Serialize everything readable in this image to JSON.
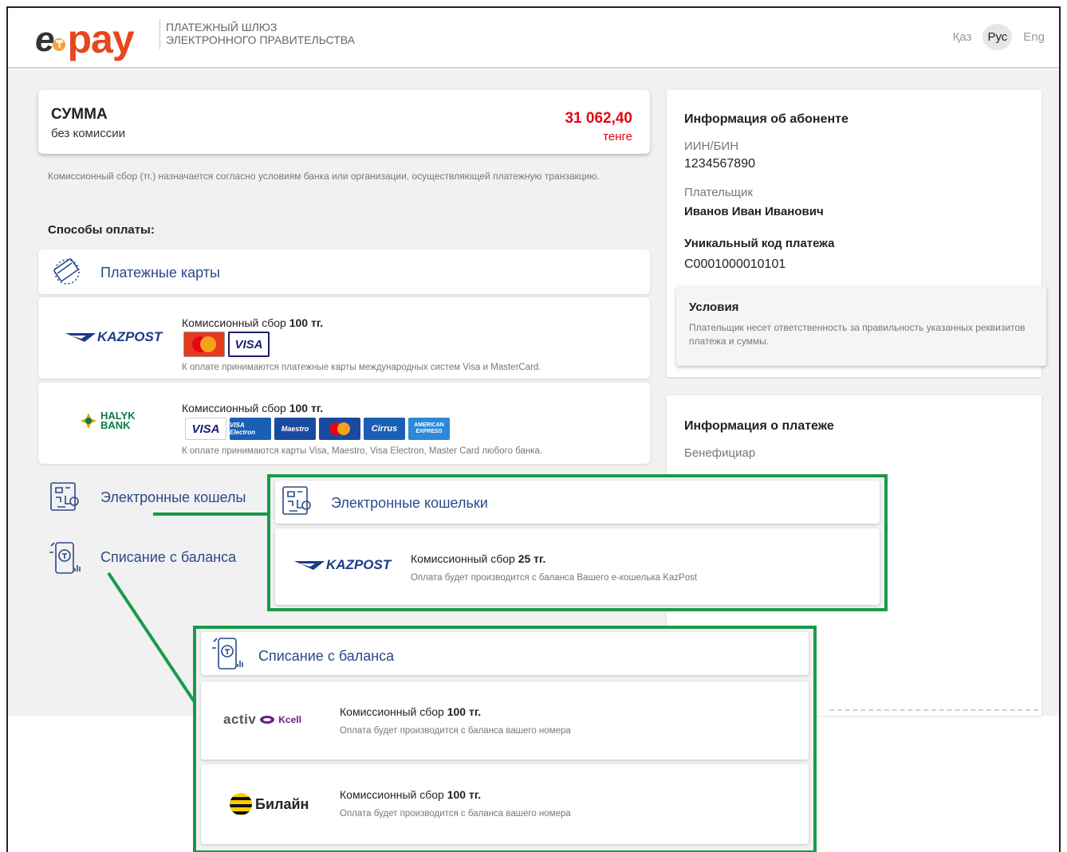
{
  "header": {
    "logo_e": "e",
    "logo_o": "₸",
    "logo_pay": "pay",
    "caption_line1": "ПЛАТЕЖНЫЙ ШЛЮЗ",
    "caption_line2": "ЭЛЕКТРОННОГО ПРАВИТЕЛЬСТВА",
    "languages": [
      {
        "label": "Қаз",
        "active": false
      },
      {
        "label": "Рус",
        "active": true
      },
      {
        "label": "Eng",
        "active": false
      }
    ]
  },
  "sum": {
    "title": "СУММА",
    "subtitle": "без комиссии",
    "amount": "31 062,40",
    "currency": "тенге"
  },
  "commission_note": "Комиссионный сбор (тг.) назначается согласно условиям банка или организации, осуществляющей платежную транзакцию.",
  "methods_title": "Способы оплаты:",
  "payment_cards": {
    "label": "Платежные карты",
    "kazpost": {
      "logo": "KAZPOST",
      "fee_prefix": "Комиссионный сбор",
      "fee_value": "100 тг.",
      "badges": [
        "MasterCard",
        "VISA"
      ],
      "note": "К оплате принимаются платежные карты международных систем Visa и MasterCard."
    },
    "halyk": {
      "logo_line1": "HALYK",
      "logo_line2": "BANK",
      "fee_prefix": "Комиссионный сбор",
      "fee_value": "100 тг.",
      "badges": [
        "VISA",
        "VISA Electron",
        "Maestro",
        "MasterCard",
        "Cirrus",
        "AMERICAN EXPRESS"
      ],
      "note": "К оплате принимаются карты Visa, Maestro, Visa Electron, Master Card любого банка."
    }
  },
  "side_menu": {
    "wallets": "Электронные кошелы",
    "balance": "Списание с баланса"
  },
  "wallet_overlay": {
    "label": "Электронные кошельки",
    "logo": "KAZPOST",
    "fee_prefix": "Комиссионный сбор",
    "fee_value": "25 тг.",
    "note": "Оплата будет производится с баланса Вашего е-кошелька KazPost"
  },
  "balance_overlay": {
    "label": "Списание с баланса",
    "activ": {
      "logo_text": "activ",
      "kcell_text": "Kcell",
      "fee_prefix": "Комиссионный сбор",
      "fee_value": "100 тг.",
      "note": "Оплата будет производится с баланса вашего номера"
    },
    "beeline": {
      "logo_text": "Билайн",
      "fee_prefix": "Комиссионный сбор",
      "fee_value": "100 тг.",
      "note": "Оплата будет производится с баланса вашего номера"
    }
  },
  "subscriber": {
    "title": "Информация об абоненте",
    "iin_label": "ИИН/БИН",
    "iin_value": "1234567890",
    "payer_label": "Плательщик",
    "payer_value": "Иванов Иван Иванович",
    "code_label": "Уникальный код платежа",
    "code_value": "C0001000010101"
  },
  "conditions": {
    "title": "Условия",
    "text": "Плательщик несет ответственность за правильность указанных реквизитов платежа и суммы."
  },
  "payment_info": {
    "title": "Информация о платеже",
    "beneficiary_label": "Бенефициар"
  },
  "colors": {
    "accent_red": "#e30613",
    "link_blue": "#2a4a8a",
    "highlight_green": "#1a9a4a",
    "logo_orange": "#e8461e"
  }
}
